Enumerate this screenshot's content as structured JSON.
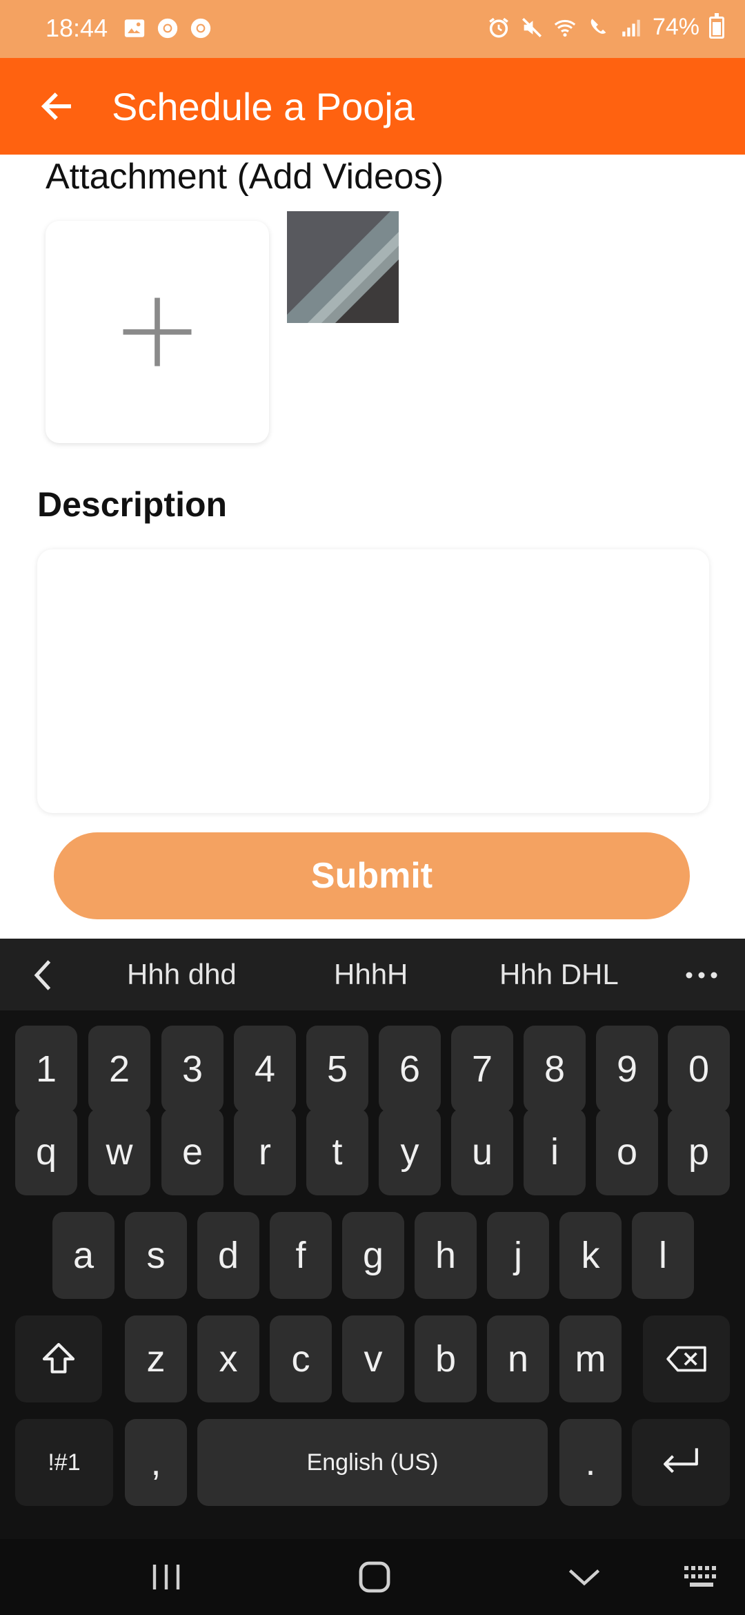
{
  "status_bar": {
    "time": "18:44",
    "battery": "74%",
    "left_icons": [
      "gallery-icon",
      "chrome-icon",
      "chrome-icon"
    ],
    "right_icons": [
      "alarm-icon",
      "mute-icon",
      "wifi-icon",
      "wifi-calling-icon",
      "signal-icon",
      "battery-icon"
    ]
  },
  "app_bar": {
    "title": "Schedule a Pooja",
    "back_icon": "arrow-left-icon",
    "background": "#ff6210"
  },
  "attachment": {
    "label": "Attachment (Add Videos)",
    "add_icon": "plus-icon"
  },
  "description": {
    "label": "Description",
    "value": ""
  },
  "submit": {
    "label": "Submit",
    "color": "#f4a261"
  },
  "keyboard": {
    "suggestions": [
      "Hhh dhd",
      "HhhH",
      "Hhh DHL"
    ],
    "rows": {
      "numbers": [
        "1",
        "2",
        "3",
        "4",
        "5",
        "6",
        "7",
        "8",
        "9",
        "0"
      ],
      "row1": [
        "q",
        "w",
        "e",
        "r",
        "t",
        "y",
        "u",
        "i",
        "o",
        "p"
      ],
      "row2": [
        "a",
        "s",
        "d",
        "f",
        "g",
        "h",
        "j",
        "k",
        "l"
      ],
      "row3": [
        "z",
        "x",
        "c",
        "v",
        "b",
        "n",
        "m"
      ]
    },
    "symbols_label": "!#1",
    "comma": ",",
    "space_label": "English (US)",
    "period": "."
  },
  "nav_bar": {
    "items": [
      "recent-apps-icon",
      "home-icon",
      "back-chevron-icon",
      "keyboard-icon"
    ]
  }
}
